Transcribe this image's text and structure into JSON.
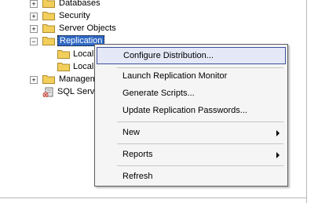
{
  "tree": {
    "items": [
      {
        "label": "Databases",
        "expander": "+"
      },
      {
        "label": "Security",
        "expander": "+"
      },
      {
        "label": "Server Objects",
        "expander": "+"
      },
      {
        "label": "Replication",
        "expander": "−"
      },
      {
        "label": "Local"
      },
      {
        "label": "Local"
      },
      {
        "label": "Managem",
        "expander": "+"
      },
      {
        "label": "SQL Serv"
      }
    ]
  },
  "context_menu": {
    "items": [
      {
        "label": "Configure Distribution..."
      },
      {
        "label": "Launch Replication Monitor"
      },
      {
        "label": "Generate Scripts..."
      },
      {
        "label": "Update Replication Passwords..."
      },
      {
        "label": "New"
      },
      {
        "label": "Reports"
      },
      {
        "label": "Refresh"
      }
    ]
  },
  "colors": {
    "selection": "#316ac5",
    "menu_highlight_bg": "#e4e8f7",
    "menu_highlight_border": "#3f4f9e",
    "folder": "#f2cf5b"
  }
}
